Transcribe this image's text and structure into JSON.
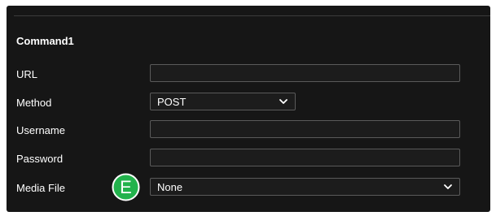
{
  "section": {
    "title": "Command1"
  },
  "fields": {
    "url": {
      "label": "URL",
      "value": ""
    },
    "method": {
      "label": "Method",
      "value": "POST"
    },
    "username": {
      "label": "Username",
      "value": ""
    },
    "password": {
      "label": "Password",
      "value": ""
    },
    "media_file": {
      "label": "Media File",
      "value": "None"
    }
  },
  "badge": {
    "letter": "E",
    "color": "#22b24c"
  },
  "icons": {
    "dropdown": "chevron-down-icon"
  },
  "colors": {
    "panel_bg": "#161616",
    "field_border": "#5a5a5a",
    "text": "#ffffff"
  }
}
